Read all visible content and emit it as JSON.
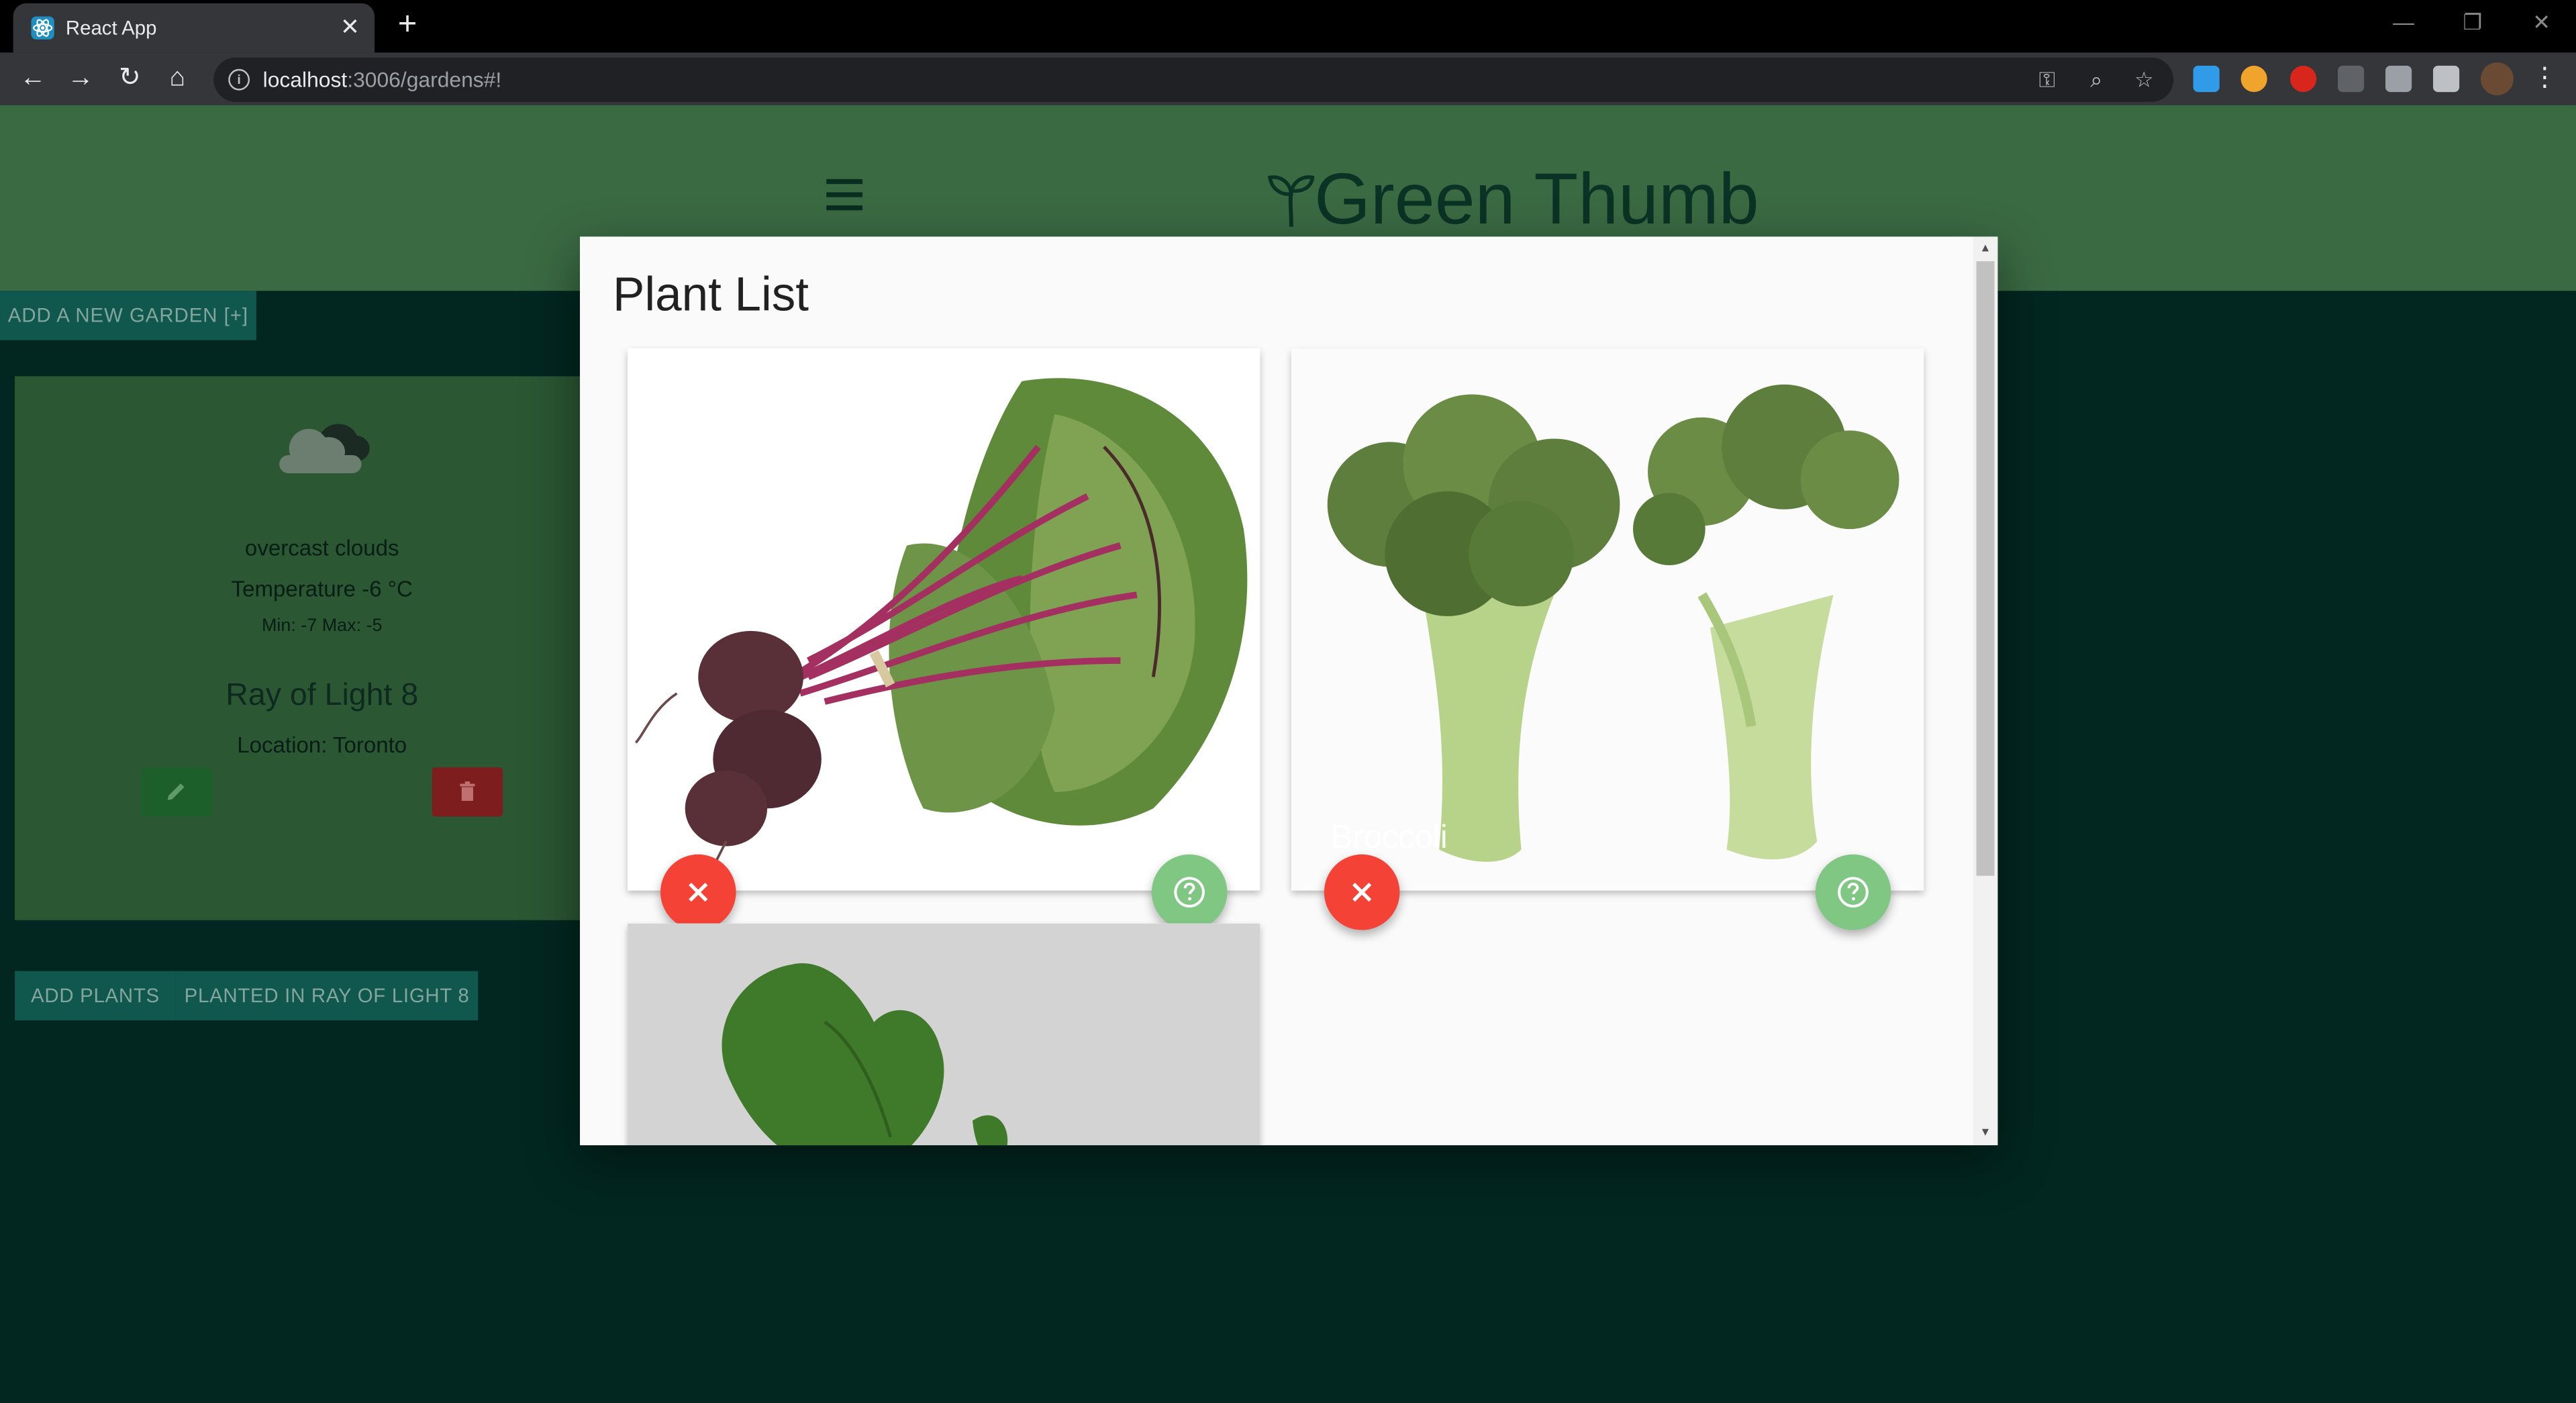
{
  "browser": {
    "tab_title": "React App",
    "url_host": "localhost",
    "url_path": ":3006/gardens#!"
  },
  "app": {
    "brand_title": "Green Thumb",
    "add_garden_label": "ADD A NEW GARDEN [+]"
  },
  "garden": {
    "weather_description": "overcast clouds",
    "temperature": "Temperature -6 °C",
    "min_max": "Min: -7 Max: -5",
    "name": "Ray of Light 8",
    "location": "Location: Toronto",
    "add_plants_label": "ADD PLANTS",
    "planted_label": "PLANTED IN RAY OF LIGHT 8"
  },
  "modal": {
    "title": "Plant List",
    "plants": [
      {
        "caption": ""
      },
      {
        "caption": "Broccoli"
      },
      {
        "caption": ""
      }
    ]
  },
  "colors": {
    "header_bg": "#3a6a42",
    "page_bg": "#022720",
    "remove_fab": "#f44336",
    "info_fab": "#81c784"
  },
  "icons": {
    "weather": "cloud-icon",
    "edit": "pencil-icon",
    "delete": "trash-icon",
    "remove": "close-icon",
    "info": "help-circle-icon"
  }
}
